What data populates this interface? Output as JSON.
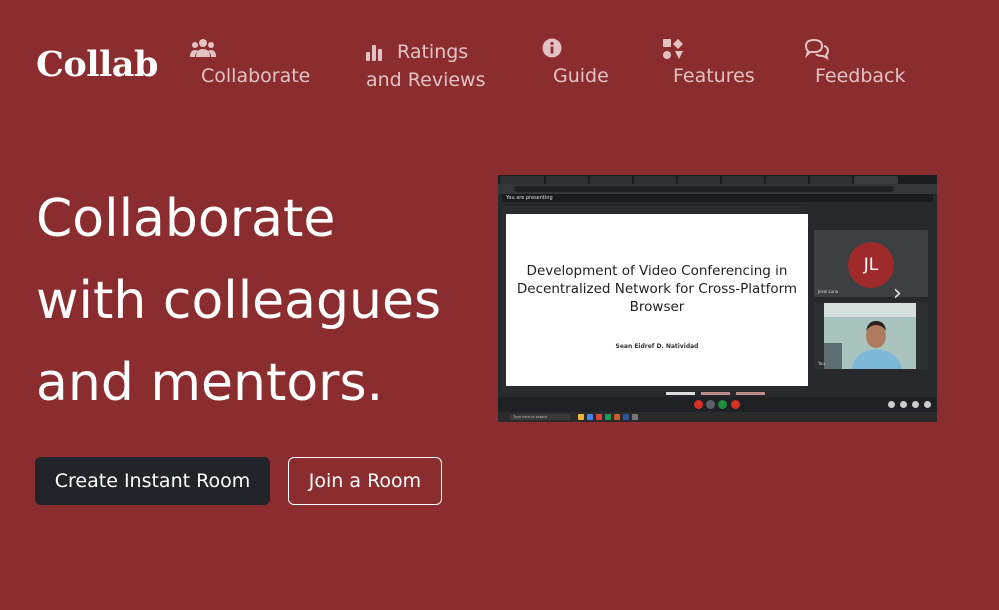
{
  "brand": "Collab",
  "nav": {
    "collaborate": "Collaborate",
    "ratings_line1": "Ratings",
    "ratings_line2": "and Reviews",
    "guide": "Guide",
    "features": "Features",
    "feedback": "Feedback"
  },
  "hero": {
    "line1": "Collaborate",
    "line2": "with colleagues",
    "line3": "and mentors."
  },
  "buttons": {
    "create": "Create Instant Room",
    "join": "Join a Room"
  },
  "preview": {
    "presenting": "You are presenting",
    "slide_title": "Development of Video Conferencing in Decentralized Network for Cross-Platform Browser",
    "slide_author": "Sean Eidref D. Natividad",
    "avatar_initials": "JL",
    "tile1_name": "Josel Luna",
    "tile2_name": "You",
    "taskbar_search": "Type here to search"
  },
  "colors": {
    "background": "#8b2c2f",
    "nav_text": "#e2c2c3",
    "dark_button": "#212529"
  }
}
